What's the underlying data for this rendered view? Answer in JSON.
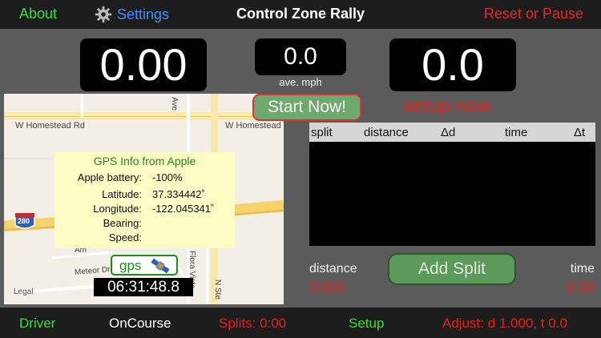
{
  "nav": {
    "about": "About",
    "settings": "Settings",
    "title": "Control Zone Rally",
    "reset": "Reset or Pause"
  },
  "readouts": {
    "distance": "0.00",
    "speed": "0.0",
    "speed_label": "ave. mph",
    "time": "0.0"
  },
  "start_button": "Start Now!",
  "setup_now": "setup now",
  "map": {
    "road_left": "W Homestead Rd",
    "road_right": "W Homestead",
    "road_meteor": "Meteor Dr",
    "road_flora": "Flora Vista",
    "road_nste": "N Ste",
    "road_ave": "Ave",
    "road_amh": "Am",
    "highway": "280",
    "legal": "Legal"
  },
  "gps_info": {
    "title": "GPS Info from Apple",
    "rows": [
      {
        "label": "Apple battery:",
        "value": "-100%"
      },
      {
        "label": "Latitude:",
        "value": "37.334442˚"
      },
      {
        "label": "Longitude:",
        "value": "-122.045341˚"
      },
      {
        "label": "Bearing:",
        "value": ""
      },
      {
        "label": "Speed:",
        "value": ""
      }
    ]
  },
  "gps_badge": "gps",
  "clock": "06:31:48.8",
  "splits_table": {
    "columns": [
      "split",
      "distance",
      "Δd",
      "time",
      "Δt"
    ]
  },
  "split_controls": {
    "distance_label": "distance",
    "distance_value": "0.000",
    "time_label": "time",
    "time_value": "0:00",
    "add_split": "Add Split"
  },
  "bottom": {
    "driver": "Driver",
    "oncourse": "OnCourse",
    "splits": "Splits: 0:00",
    "setup": "Setup",
    "adjust": "Adjust: d 1.000, t 0.0"
  },
  "colors": {
    "green": "#3fd93f",
    "red": "#e0231f",
    "blue": "#3e8eff",
    "note_yellow": "#fcfcc5"
  }
}
